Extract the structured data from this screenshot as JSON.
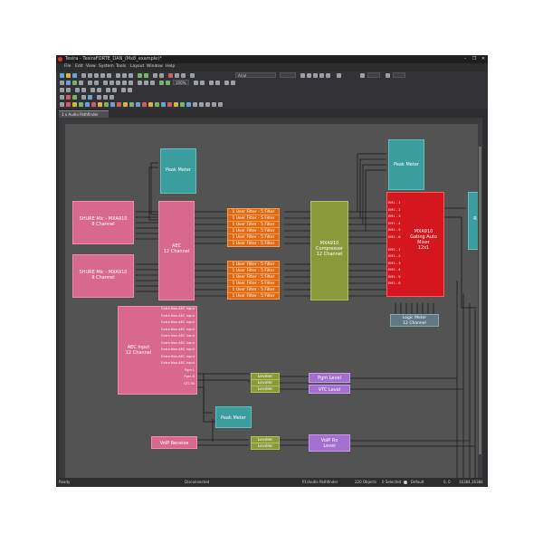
{
  "window": {
    "title": "Tesira - TesiraFORTE_DAN_(Mx8_example)*",
    "controls": [
      "–",
      "❐",
      "✕"
    ]
  },
  "menu": [
    "File",
    "Edit",
    "View",
    "System",
    "Tools",
    "Layout",
    "Window",
    "Help"
  ],
  "toolbar": {
    "font_select": "Arial",
    "zoom": "100%"
  },
  "tab": {
    "label": "1 x Audio Pathfinder"
  },
  "blocks": {
    "shure_mic_1": "SHURE Mic - MXA910\n8 Channel",
    "shure_mic_2": "SHURE Mic - MXA910\n8 Channel",
    "peak_meter_1": "Peak Meter",
    "peak_meter_2": "Peak Meter",
    "peak_meter_3": "Peak Meter",
    "aec": "AEC\n12 Channel",
    "aec_input": "AEC Input\n12 Channel",
    "compressor": "MXA910\nCompressor\n12 Channel",
    "automixer": "MXA910\nGating Auto\nMixer\n12x1",
    "logic_meter": "Logic Meter\n12 Channel",
    "pgm_level": "Pgm Level",
    "vtc_level": "VTC Level",
    "voip_receive": "VoIP Receive",
    "voip_rx_level": "VoIP Rx\nLevel",
    "right_partial": "R"
  },
  "filter_label": "1 User Filter - 5 Filter",
  "leveler_label": "Leveler",
  "aec_input_rows": [
    "Extra Non-AEC Input",
    "Extra Non-AEC Input",
    "Extra Non-AEC Input",
    "Extra Non-AEC Input",
    "Extra Non-AEC Input",
    "Extra Non-AEC Input",
    "Extra Non-AEC Input",
    "Extra Non-AEC Input",
    "Extra Non-AEC Input",
    "Pgm L",
    "Pgm R",
    "VTC IN"
  ],
  "automixer_rows": [
    "EM1 - 1",
    "EM1 - 2",
    "EM1 - 3",
    "EM1 - 4",
    "EM1 - 5",
    "EM1 - 6",
    "EM2 - 1",
    "EM2 - 2",
    "EM2 - 3",
    "EM2 - 4",
    "EM2 - 5",
    "EM2 - 6"
  ],
  "status": {
    "left": "Ready",
    "connection": "Disconnected",
    "layout": "P1\\Audio Pathfinder",
    "objects": "220 Objects",
    "selected": "0 Selected",
    "mode": "Default",
    "coords": "0, 0",
    "size": "16384,16384"
  },
  "colors": {
    "pink": "#d9688f",
    "teal": "#3b9d9d",
    "orange": "#e06a12",
    "olive": "#8a9a3a",
    "red": "#d4161e",
    "purple": "#a36fd0",
    "canvas": "#535353"
  }
}
